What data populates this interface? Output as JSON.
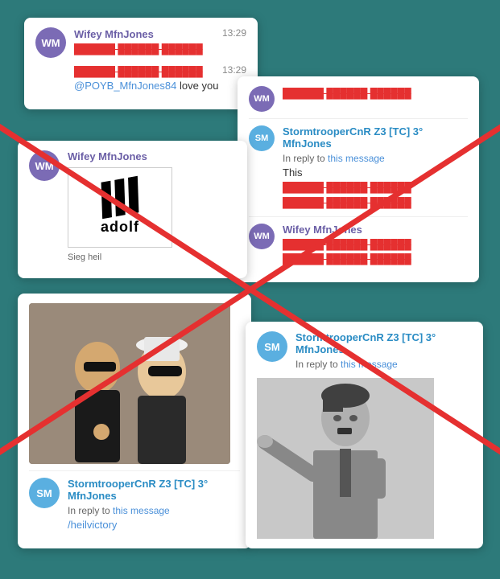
{
  "background": "#2d7a7a",
  "cards": {
    "card1": {
      "user1": {
        "initials": "WM",
        "name": "Wifey MfnJones",
        "timestamp": "13:29",
        "message_censored": "/nigger nigger nigger"
      },
      "user2": {
        "timestamp": "13:29",
        "message_censored": "/nigger nigger nigger"
      },
      "user3": {
        "mention": "@POYB_MfnJones84",
        "message": " love you"
      }
    },
    "card2": {
      "user1": {
        "initials": "WM",
        "message_censored": "/nigger nigger nigger"
      },
      "user2": {
        "initials": "SM",
        "name": "StormtrooperCnR Z3 [TC] 3° MfnJones",
        "reply_prefix": "In reply to ",
        "reply_link": "this message",
        "message": "This",
        "censored_line1": "/nigger nigger nigger",
        "censored_line2": "/nigger nigger nigger"
      },
      "user3": {
        "initials": "WM",
        "name": "Wifey MfnJones",
        "censored_line1": "/pigger nigger nigger",
        "censored_line2": "/nigger nigger nigger"
      }
    },
    "card3": {
      "user1": {
        "initials": "WM",
        "name": "Wifey MfnJones",
        "image_text": "adolf",
        "caption": "Sieg heil"
      }
    },
    "card4": {
      "user1": {
        "initials": "SM",
        "name": "StormtrooperCnR Z3 [TC] 3° MfnJones",
        "reply_prefix": "In reply to ",
        "reply_link": "this message",
        "heil_link": "/heilvictory"
      }
    },
    "card5": {
      "user1": {
        "initials": "SM",
        "name": "StormtrooperCnR Z3 [TC] 3° MfnJones",
        "reply_prefix": "In reply to ",
        "reply_link": "this message"
      }
    }
  },
  "red_lines": {
    "description": "Two diagonal red lines forming an X across the image"
  }
}
